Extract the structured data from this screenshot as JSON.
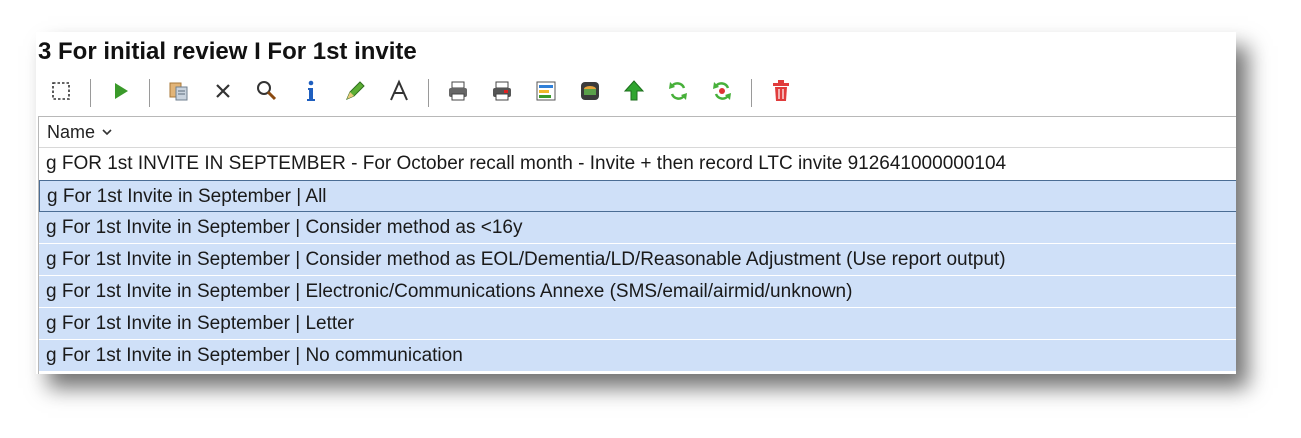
{
  "window": {
    "title": "3 For initial review I For 1st invite"
  },
  "list": {
    "header": "Name",
    "rows": [
      "g FOR 1st INVITE IN SEPTEMBER - For October recall month - Invite + then record LTC invite 912641000000104",
      "g For 1st Invite in September | All",
      "g For 1st Invite in September | Consider method as <16y",
      "g For 1st Invite in September | Consider method as EOL/Dementia/LD/Reasonable Adjustment (Use report output)",
      "g For 1st Invite in September | Electronic/Communications Annexe (SMS/email/airmid/unknown)",
      "g For 1st Invite in September | Letter",
      "g For 1st Invite in September | No communication"
    ]
  },
  "colors": {
    "selection": "#cfe0f8",
    "focus_border": "#4b6d94"
  }
}
